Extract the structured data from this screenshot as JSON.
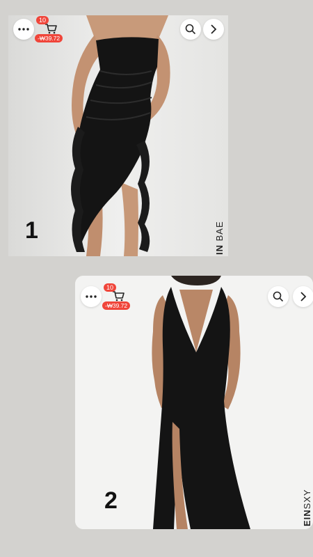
{
  "cards": [
    {
      "number": "1",
      "brand_strong": "IN",
      "brand_rest": " BAE",
      "cart_count": "10",
      "discount": "-₩39.72",
      "icons": {
        "more": "more-horizontal-icon",
        "cart": "shopping-cart-icon",
        "search": "search-icon",
        "next": "chevron-right-icon"
      },
      "image": "black strapless ruffle midi dress"
    },
    {
      "number": "2",
      "brand_strong": "EIN",
      "brand_rest": "SXY",
      "cart_count": "10",
      "discount": "-₩39.72",
      "icons": {
        "more": "more-horizontal-icon",
        "cart": "shopping-cart-icon",
        "search": "search-icon",
        "next": "chevron-right-icon"
      },
      "image": "black halter maxi dress with side slit"
    }
  ],
  "colors": {
    "background": "#d3d2cf",
    "badge": "#f0453a",
    "dress": "#141414"
  }
}
